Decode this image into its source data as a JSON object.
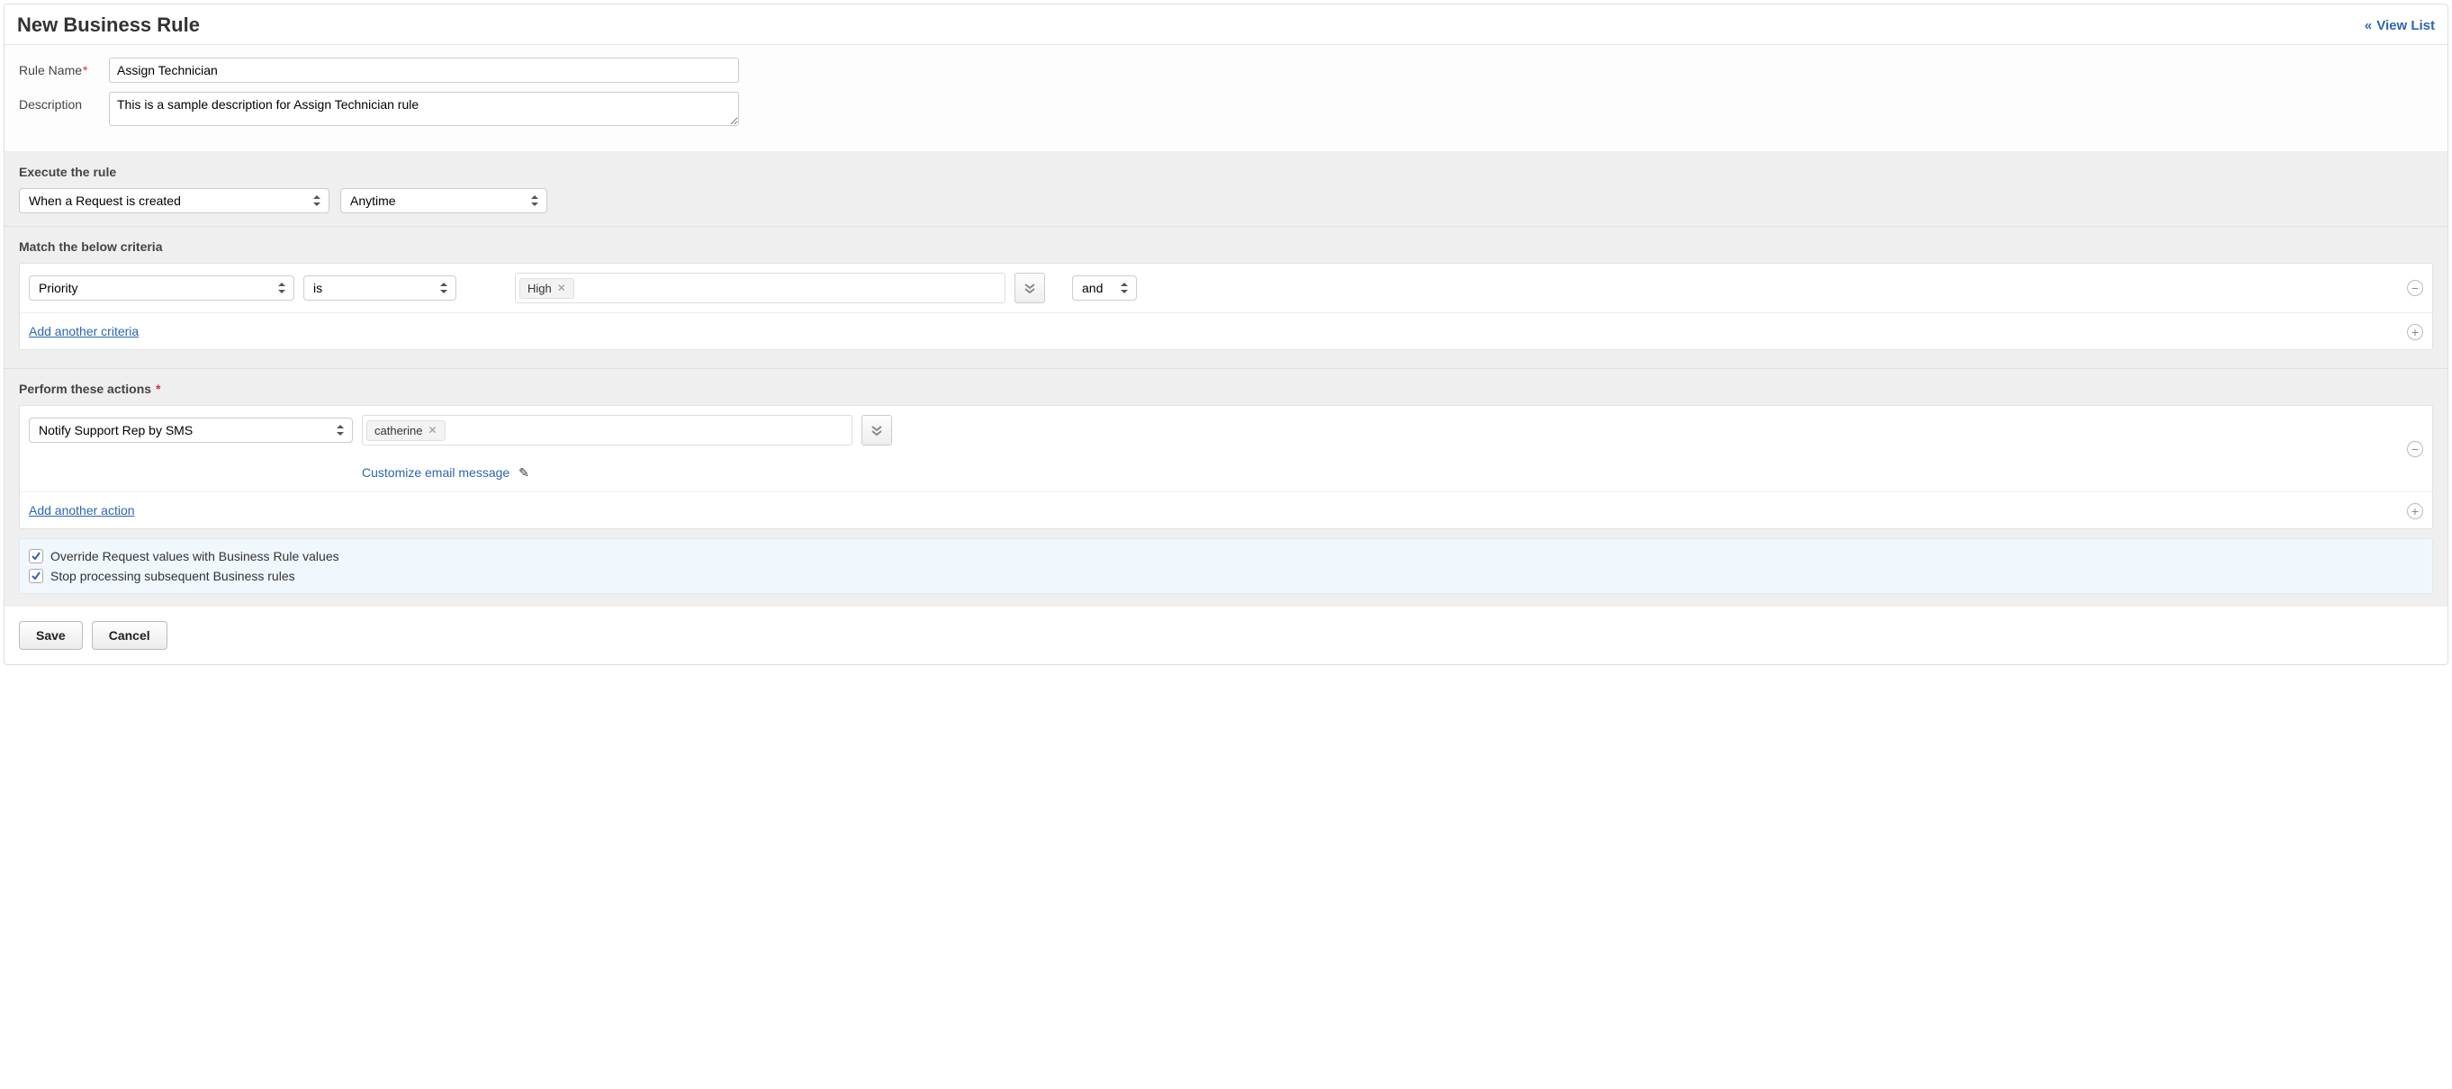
{
  "header": {
    "title": "New Business Rule",
    "view_list": "View List",
    "view_list_chevron": "«"
  },
  "form": {
    "rule_name_label": "Rule Name",
    "rule_name_value": "Assign Technician",
    "description_label": "Description",
    "description_value": "This is a sample description for Assign Technician rule"
  },
  "execute": {
    "title": "Execute the rule",
    "when_value": "When a Request is created",
    "time_value": "Anytime"
  },
  "criteria": {
    "title": "Match the below criteria",
    "field_value": "Priority",
    "operator_value": "is",
    "token_value": "High",
    "conjunction_value": "and",
    "add_link": "Add another criteria"
  },
  "actions": {
    "title": "Perform these actions",
    "action_value": "Notify Support Rep by SMS",
    "token_value": "catherine",
    "customize_link": "Customize email message",
    "add_link": "Add another action"
  },
  "options": {
    "override_label": "Override Request values with Business Rule values",
    "stop_label": "Stop processing subsequent Business rules"
  },
  "footer": {
    "save": "Save",
    "cancel": "Cancel"
  }
}
